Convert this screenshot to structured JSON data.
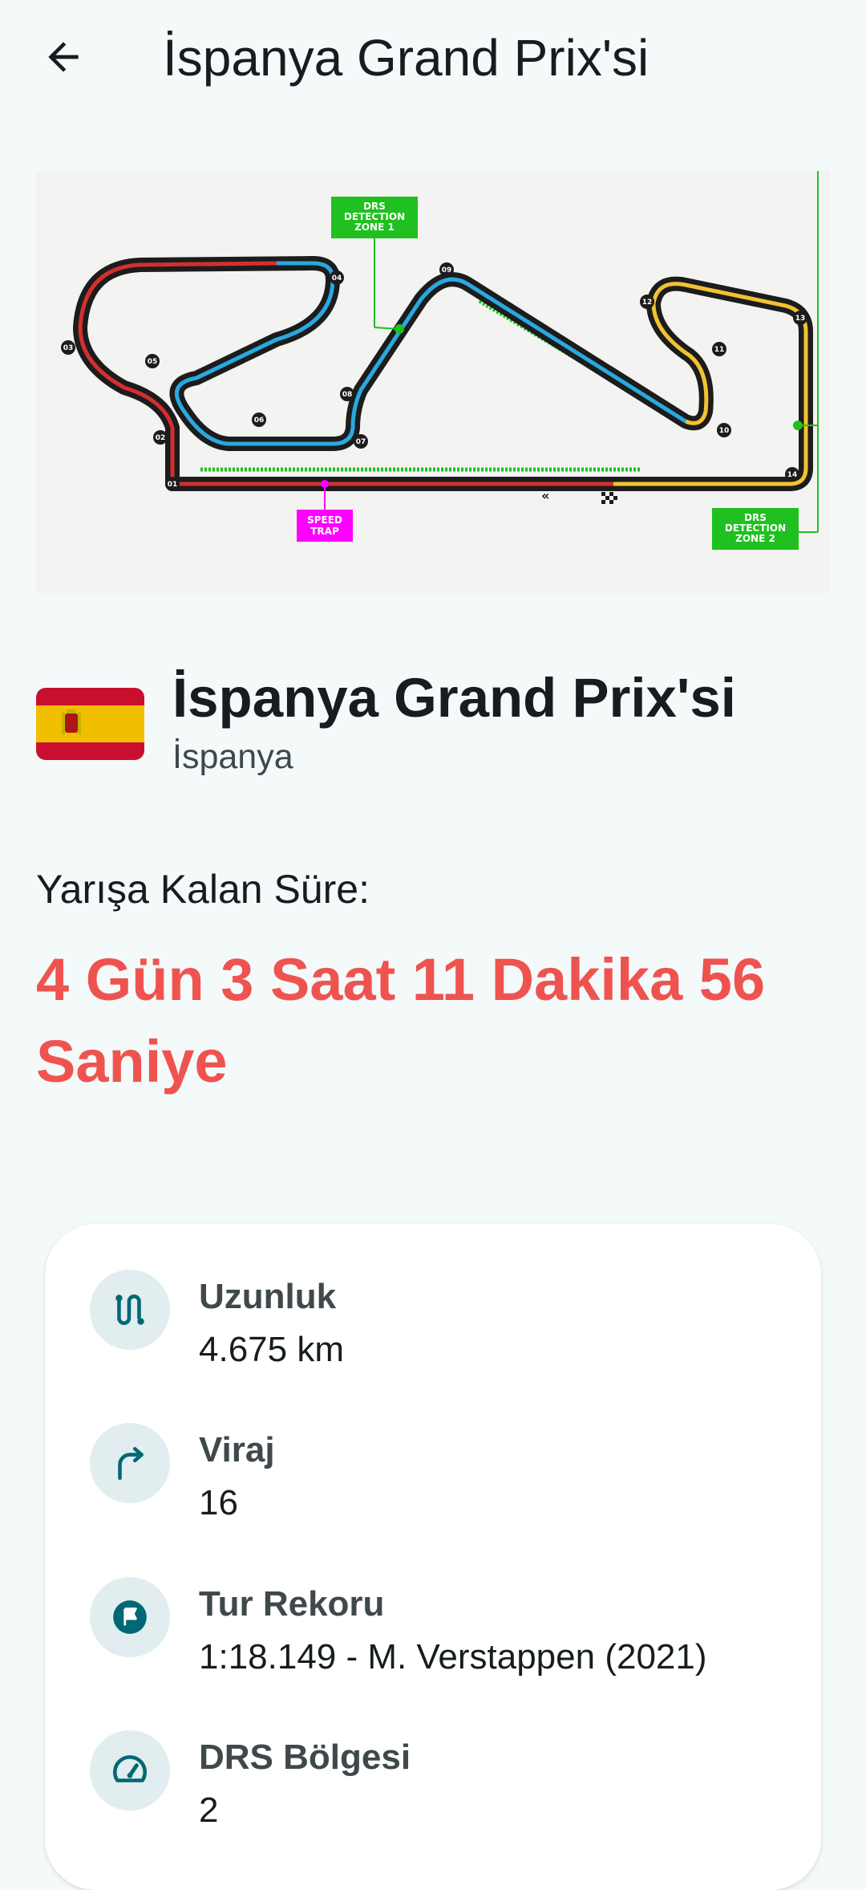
{
  "appbar": {
    "title": "İspanya Grand Prix'si",
    "back_icon": "arrow-back-icon"
  },
  "track": {
    "corner_labels": [
      "01",
      "02",
      "03",
      "04",
      "05",
      "06",
      "07",
      "08",
      "09",
      "10",
      "11",
      "12",
      "13",
      "14"
    ],
    "drs_zone_1": [
      "DRS",
      "DETECTION",
      "ZONE 1"
    ],
    "drs_zone_2": [
      "DRS",
      "DETECTION",
      "ZONE 2"
    ],
    "speed_trap": [
      "SPEED",
      "TRAP"
    ],
    "colors": {
      "sector1": "#d32f2f",
      "sector2": "#29a9e0",
      "sector3": "#f2c230",
      "drs": "#1fc01f",
      "speed_trap": "#ff00ff",
      "track": "#1c1c1c"
    }
  },
  "race": {
    "name": "İspanya Grand Prix'si",
    "country": "İspanya",
    "flag_icon": "spain-flag-icon"
  },
  "countdown": {
    "label": "Yarışa Kalan Süre:",
    "value": "4 Gün 3 Saat 11 Dakika 56 Saniye"
  },
  "info": {
    "items": [
      {
        "icon": "route-icon",
        "label": "Uzunluk",
        "value": "4.675 km"
      },
      {
        "icon": "turn-right-icon",
        "label": "Viraj",
        "value": "16"
      },
      {
        "icon": "flag-icon",
        "label": "Tur Rekoru",
        "value": "1:18.149 - M. Verstappen (2021)"
      },
      {
        "icon": "speed-icon",
        "label": "DRS Bölgesi",
        "value": "2"
      }
    ]
  },
  "theme": {
    "accent_red": "#ef5350",
    "background": "#f4f9f9",
    "icon_bg": "#e1edee",
    "icon_color": "#006874"
  }
}
